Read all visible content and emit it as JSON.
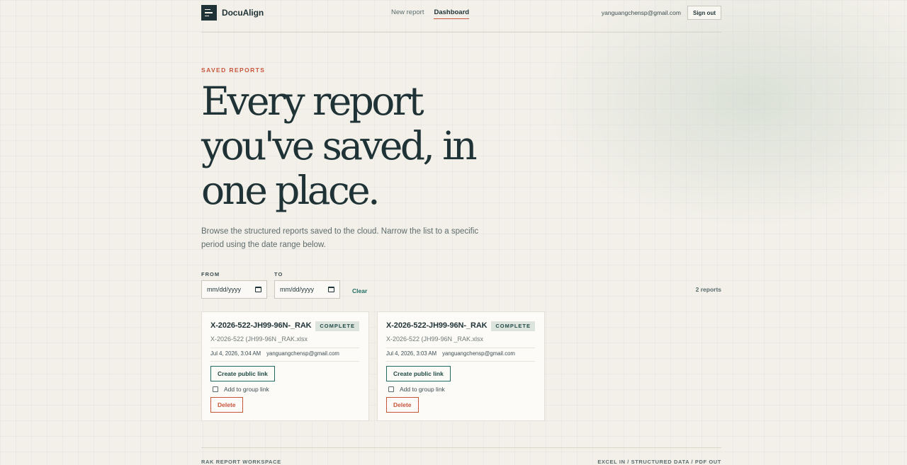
{
  "header": {
    "app_name": "DocuAlign",
    "nav": [
      {
        "label": "New report",
        "active": false
      },
      {
        "label": "Dashboard",
        "active": true
      }
    ],
    "user_email": "yanguangchensp@gmail.com",
    "sign_out_label": "Sign out"
  },
  "hero": {
    "eyebrow": "SAVED REPORTS",
    "title_lines": [
      "Every report",
      "you've saved, in",
      "one place."
    ],
    "subtitle": "Browse the structured reports saved to the cloud. Narrow the list to a specific period using the date range below."
  },
  "filters": {
    "from_label": "FROM",
    "from_placeholder": "mm/dd/yyyy",
    "to_label": "TO",
    "to_placeholder": "mm/dd/yyyy",
    "clear_label": "Clear",
    "count_text": "2 reports"
  },
  "reports": [
    {
      "title": "X-2026-522-JH99-96N-_RAK",
      "status": "COMPLETE",
      "file": "X-2026-522 (JH99-96N _RAK.xlsx",
      "date": "Jul 4, 2026, 3:04 AM",
      "owner": "yanguangchensp@gmail.com",
      "public_link_label": "Create public link",
      "group_label": "Add to group link",
      "delete_label": "Delete"
    },
    {
      "title": "X-2026-522-JH99-96N-_RAK",
      "status": "COMPLETE",
      "file": "X-2026-522 (JH99-96N _RAK.xlsx",
      "date": "Jul 4, 2026, 3:03 AM",
      "owner": "yanguangchensp@gmail.com",
      "public_link_label": "Create public link",
      "group_label": "Add to group link",
      "delete_label": "Delete"
    }
  ],
  "footer": {
    "left": "RAK REPORT WORKSPACE",
    "right": "EXCEL IN / STRUCTURED DATA / PDF OUT"
  },
  "colors": {
    "accent": "#c8553d",
    "ink": "#1f3236",
    "teal": "#1f6b63",
    "background": "#f2f0e9"
  }
}
